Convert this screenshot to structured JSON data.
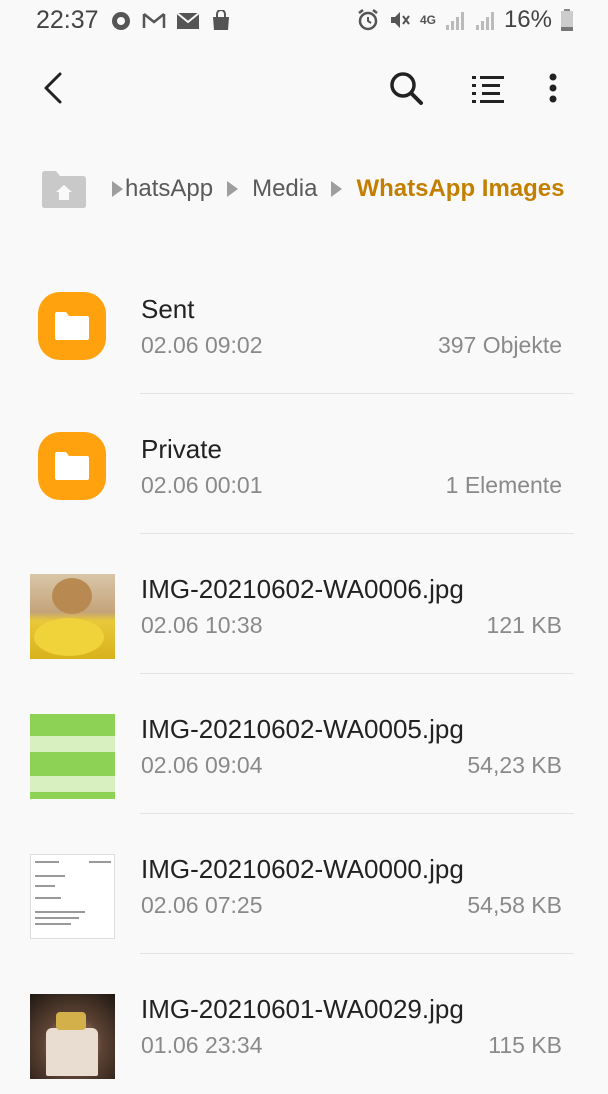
{
  "status_bar": {
    "time": "22:37",
    "battery_percent": "16%",
    "network": "4G",
    "left_icons": [
      "chat-icon",
      "gmail-icon",
      "mail-icon",
      "shopping-bag-icon"
    ],
    "right_icons": [
      "alarm-icon",
      "mute-icon",
      "signal-icon",
      "signal-icon",
      "battery-icon"
    ]
  },
  "toolbar": {
    "back_icon": "back-arrow-icon",
    "search_icon": "search-icon",
    "sort_icon": "sort-list-icon",
    "more_icon": "more-vert-icon"
  },
  "breadcrumb": {
    "home_icon": "home-folder-icon",
    "items": [
      "hatsApp",
      "Media",
      "WhatsApp Images"
    ]
  },
  "colors": {
    "accent": "#c47f00",
    "folder": "#ffa20d"
  },
  "files": [
    {
      "name": "Sent",
      "date": "02.06 09:02",
      "size": "397 Objekte",
      "type": "folder"
    },
    {
      "name": "Private",
      "date": "02.06 00:01",
      "size": "1 Elemente",
      "type": "folder"
    },
    {
      "name": "IMG-20210602-WA0006.jpg",
      "date": "02.06 10:38",
      "size": "121 KB",
      "type": "image"
    },
    {
      "name": "IMG-20210602-WA0005.jpg",
      "date": "02.06 09:04",
      "size": "54,23 KB",
      "type": "image"
    },
    {
      "name": "IMG-20210602-WA0000.jpg",
      "date": "02.06 07:25",
      "size": "54,58 KB",
      "type": "image"
    },
    {
      "name": "IMG-20210601-WA0029.jpg",
      "date": "01.06 23:34",
      "size": "115 KB",
      "type": "image"
    }
  ]
}
